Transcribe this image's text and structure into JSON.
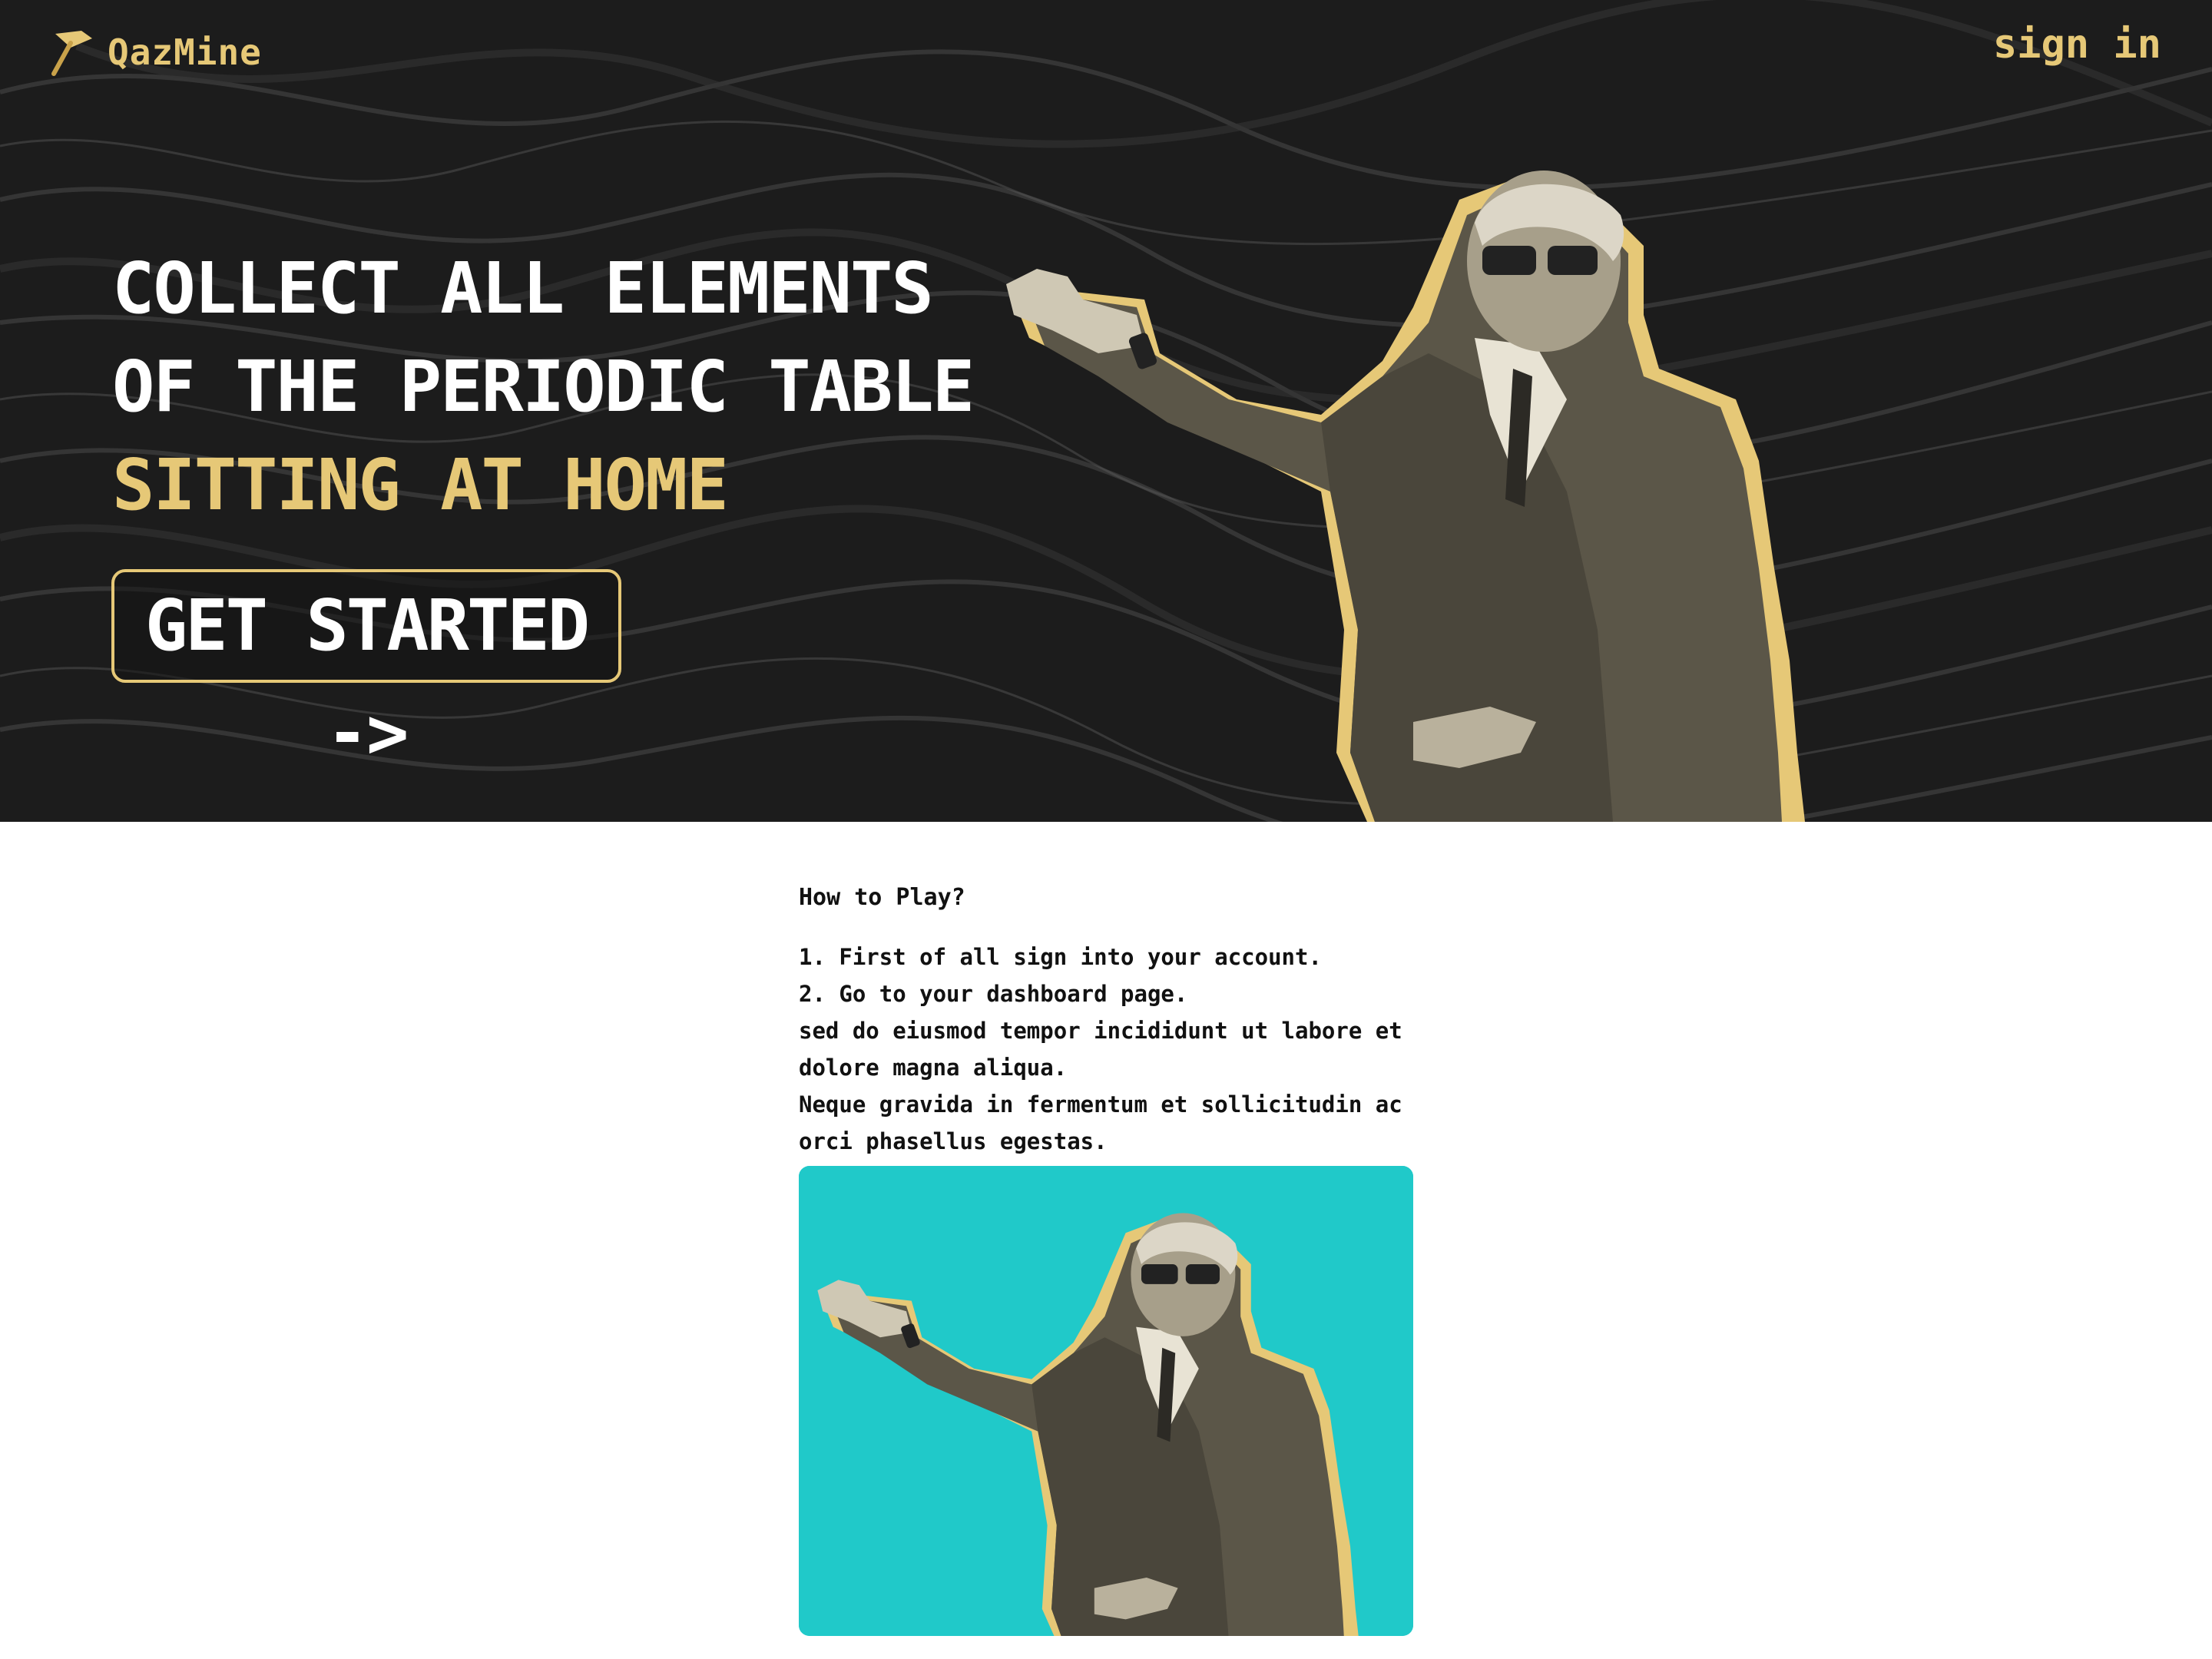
{
  "nav": {
    "brand": "QazMine",
    "brand_icon": "pickaxe-icon",
    "signin_label": "sign in"
  },
  "hero": {
    "headline_line1": "COLLECT ALL ELEMENTS",
    "headline_line2": "OF THE PERIODIC TABLE",
    "headline_line3": "SITTING AT HOME",
    "cta_label": "GET STARTED ->"
  },
  "howto": {
    "title": "How to Play?",
    "steps": [
      "1. First of all sign into your account.",
      "2. Go to your dashboard page.",
      "sed do eiusmod tempor incididunt ut labore et dolore magna aliqua.",
      "Neque gravida in fermentum et sollicitudin ac orci phasellus egestas."
    ]
  },
  "colors": {
    "accent": "#e6c877",
    "hero_bg": "#1b1b1b",
    "card_bg": "#20c9c9",
    "text": "#111111"
  }
}
